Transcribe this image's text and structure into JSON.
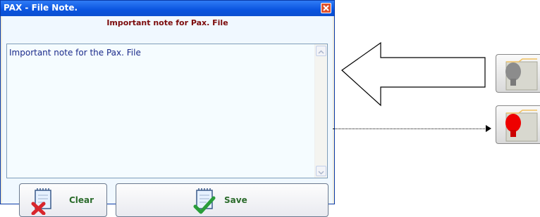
{
  "dialog": {
    "title": "PAX - File Note.",
    "heading": "Important note for Pax. File",
    "note_text": "Important note for the Pax. File",
    "clear_label": "Clear",
    "save_label": "Save"
  },
  "colors": {
    "titlebar": "#0a54df",
    "heading": "#7b0a0a",
    "note_text": "#1a2a8a",
    "button_text": "#2b6b2b",
    "content_bg": "#f0f8ff"
  },
  "icons": {
    "close": "close-icon",
    "clear": "notepad-clear-icon",
    "save": "notepad-save-icon",
    "folder_inactive": "folder-bulb-grey-icon",
    "folder_active": "folder-bulb-red-icon"
  }
}
